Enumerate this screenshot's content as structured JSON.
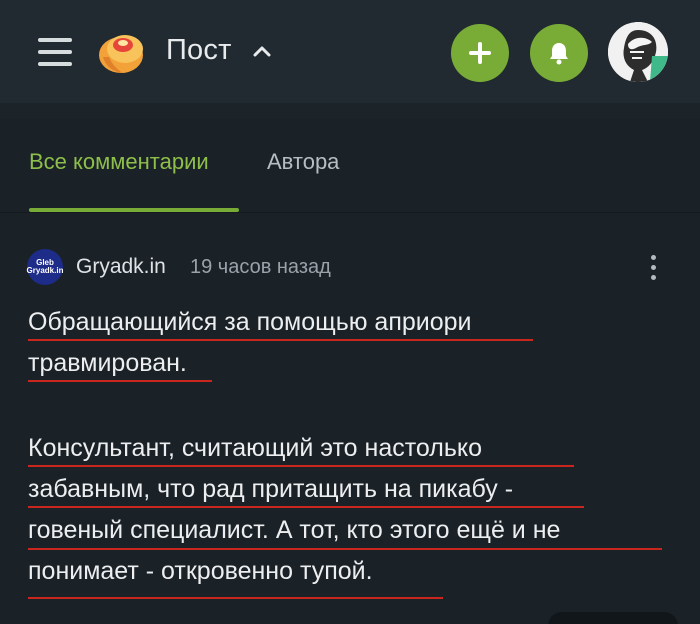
{
  "header": {
    "title": "Пост",
    "menu_icon": "hamburger-menu-icon",
    "logo_icon": "pikabu-logo-icon",
    "caret_icon": "chevron-up-icon",
    "add_icon": "plus-icon",
    "notifications_icon": "bell-icon",
    "accent_color": "#78ac37"
  },
  "tabs": {
    "all_comments": "Все комментарии",
    "author": "Автора"
  },
  "comment": {
    "avatar_text_top": "Gleb",
    "avatar_text_bottom": "Gryadk.in",
    "author": "Gryadk.in",
    "time": "19 часов назад",
    "lines": [
      "Обращающийся за помощью априори",
      "травмирован.",
      "Консультант, считающий это настолько",
      "забавным, что рад притащить на пикабу -",
      "говеный специалист. А тот, кто этого ещё и не",
      "понимает - откровенно тупой."
    ],
    "underline_color": "#c9271e"
  }
}
